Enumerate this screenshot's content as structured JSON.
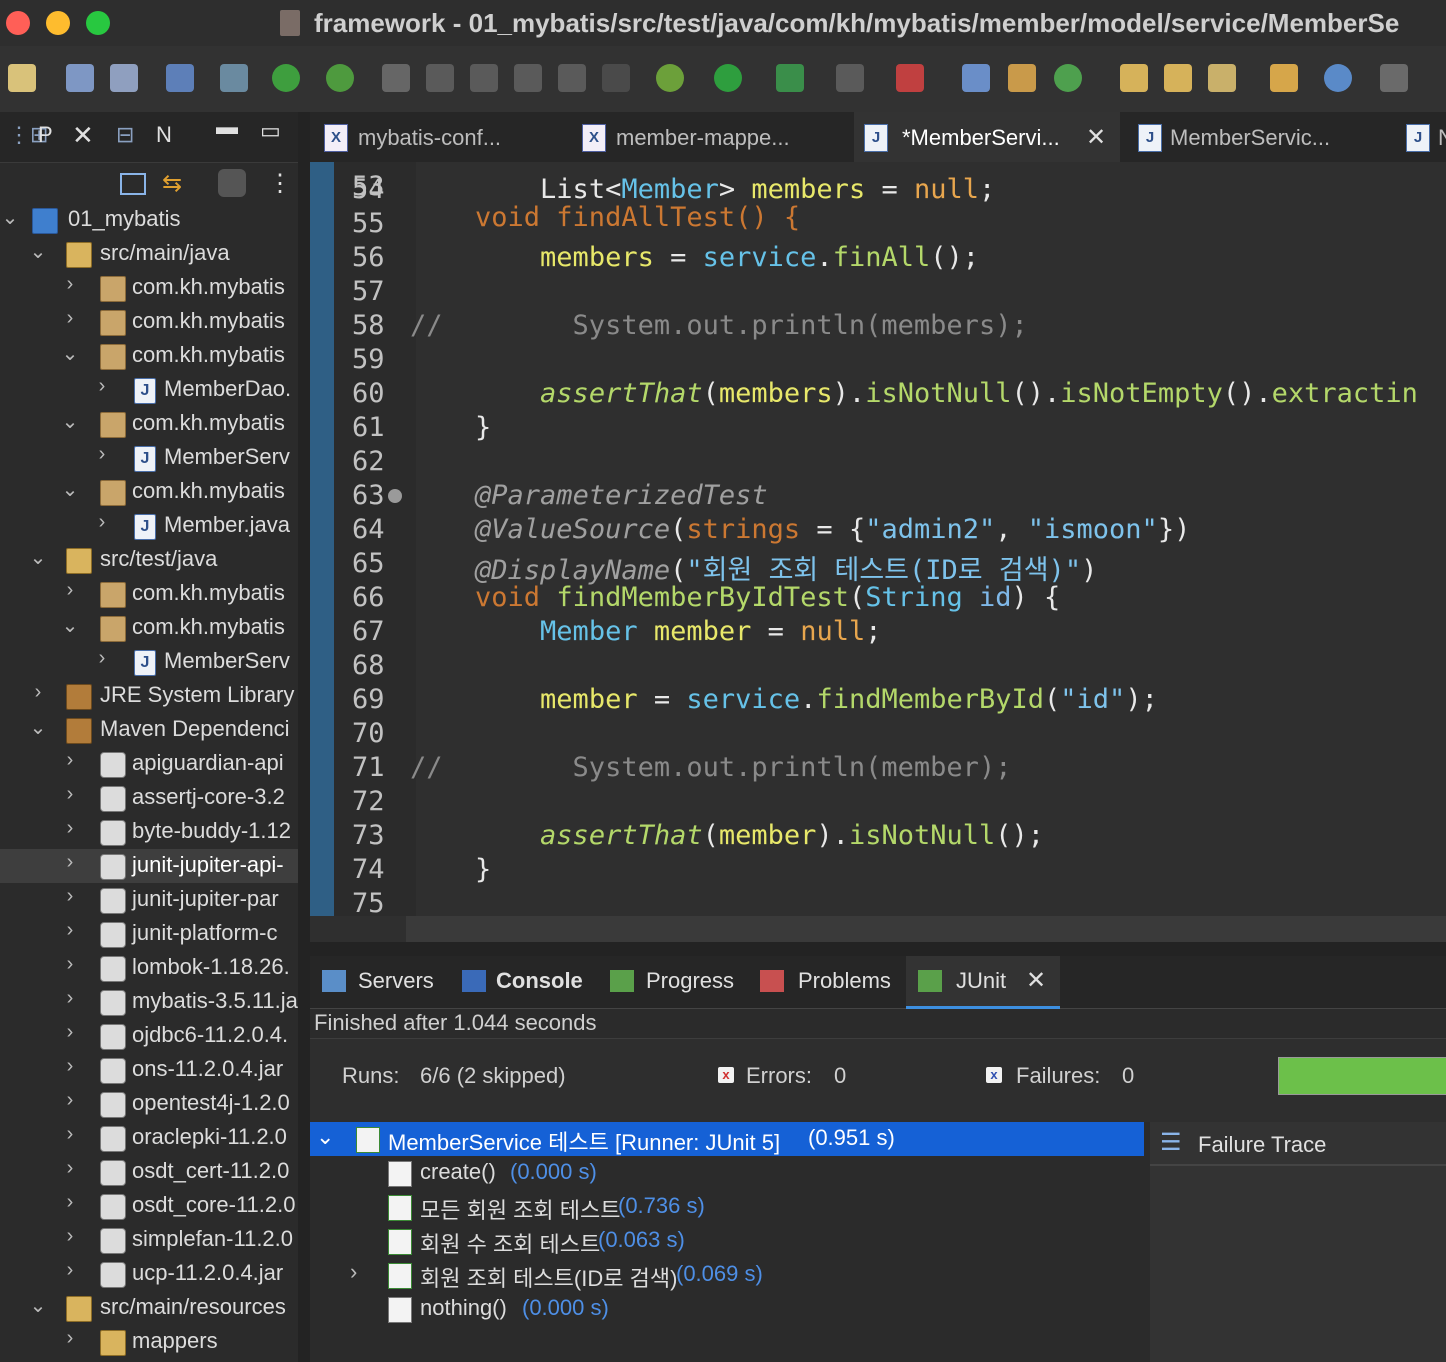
{
  "window": {
    "title": "framework - 01_mybatis/src/test/java/com/kh/mybatis/member/model/service/MemberSe"
  },
  "left_panel": {
    "tabs": [
      {
        "label": "P"
      },
      {
        "label": "N"
      }
    ],
    "tree": [
      {
        "label": "01_mybatis"
      },
      {
        "label": "src/main/java"
      },
      {
        "label": "com.kh.mybatis"
      },
      {
        "label": "com.kh.mybatis"
      },
      {
        "label": "com.kh.mybatis"
      },
      {
        "label": "MemberDao."
      },
      {
        "label": "com.kh.mybatis"
      },
      {
        "label": "MemberServ"
      },
      {
        "label": "com.kh.mybatis"
      },
      {
        "label": "Member.java"
      },
      {
        "label": "src/test/java"
      },
      {
        "label": "com.kh.mybatis"
      },
      {
        "label": "com.kh.mybatis"
      },
      {
        "label": "MemberServ"
      },
      {
        "label": "JRE System Library"
      },
      {
        "label": "Maven Dependenci"
      },
      {
        "label": "apiguardian-api"
      },
      {
        "label": "assertj-core-3.2"
      },
      {
        "label": "byte-buddy-1.12"
      },
      {
        "label": "junit-jupiter-api-"
      },
      {
        "label": "junit-jupiter-par"
      },
      {
        "label": "junit-platform-c"
      },
      {
        "label": "lombok-1.18.26."
      },
      {
        "label": "mybatis-3.5.11.ja"
      },
      {
        "label": "ojdbc6-11.2.0.4."
      },
      {
        "label": "ons-11.2.0.4.jar"
      },
      {
        "label": "opentest4j-1.2.0"
      },
      {
        "label": "oraclepki-11.2.0"
      },
      {
        "label": "osdt_cert-11.2.0"
      },
      {
        "label": "osdt_core-11.2.0"
      },
      {
        "label": "simplefan-11.2.0"
      },
      {
        "label": "ucp-11.2.0.4.jar"
      },
      {
        "label": "src/main/resources"
      },
      {
        "label": "mappers"
      }
    ]
  },
  "editor": {
    "tabs": [
      {
        "label": "mybatis-conf..."
      },
      {
        "label": "member-mappe..."
      },
      {
        "label": "*MemberServi..."
      },
      {
        "label": "MemberServic..."
      },
      {
        "label": "N"
      }
    ],
    "partial_line": "    void findAllTest() {",
    "lines": [
      {
        "n": "54",
        "t": "List<Member> members = null;"
      },
      {
        "n": "55",
        "t": ""
      },
      {
        "n": "56",
        "t": "members = service.finAll();"
      },
      {
        "n": "57",
        "t": ""
      },
      {
        "n": "58",
        "t": "//        System.out.println(members);"
      },
      {
        "n": "59",
        "t": ""
      },
      {
        "n": "60",
        "t": "assertThat(members).isNotNull().isNotEmpty().extractin"
      },
      {
        "n": "61",
        "t": "}"
      },
      {
        "n": "62",
        "t": ""
      },
      {
        "n": "63",
        "t": "@ParameterizedTest"
      },
      {
        "n": "64",
        "t": "@ValueSource(strings = {\"admin2\", \"ismoon\"})"
      },
      {
        "n": "65",
        "t": "@DisplayName(\"회원 조회 테스트(ID로 검색)\")"
      },
      {
        "n": "66",
        "t": "void findMemberByIdTest(String id) {"
      },
      {
        "n": "67",
        "t": "Member member = null;"
      },
      {
        "n": "68",
        "t": ""
      },
      {
        "n": "69",
        "t": "member = service.findMemberById(\"id\");"
      },
      {
        "n": "70",
        "t": ""
      },
      {
        "n": "71",
        "t": "//        System.out.println(member);"
      },
      {
        "n": "72",
        "t": ""
      },
      {
        "n": "73",
        "t": "assertThat(member).isNotNull();"
      },
      {
        "n": "74",
        "t": "}"
      },
      {
        "n": "75",
        "t": ""
      }
    ]
  },
  "bottom_panel": {
    "tabs": [
      {
        "label": "Servers"
      },
      {
        "label": "Console"
      },
      {
        "label": "Progress"
      },
      {
        "label": "Problems"
      },
      {
        "label": "JUnit"
      }
    ],
    "status": "Finished after 1.044 seconds",
    "runs_label": "Runs:",
    "runs_value": "6/6 (2 skipped)",
    "errors_label": "Errors:",
    "errors_value": "0",
    "failures_label": "Failures:",
    "failures_value": "0",
    "progress": 1.0,
    "progress_color": "#6cc04a",
    "failure_trace_label": "Failure Trace",
    "tests": [
      {
        "name": "MemberService 테스트 [Runner: JUnit 5]",
        "time": "(0.951 s)"
      },
      {
        "name": "create()",
        "time": "(0.000 s)"
      },
      {
        "name": "모든 회원 조회 테스트",
        "time": "(0.736 s)"
      },
      {
        "name": "회원 수 조회 테스트",
        "time": "(0.063 s)"
      },
      {
        "name": "회원 조회 테스트(ID로 검색)",
        "time": "(0.069 s)"
      },
      {
        "name": "nothing()",
        "time": "(0.000 s)"
      }
    ]
  },
  "colors": {
    "selection": "#1561d6",
    "accent": "#3d8fe0",
    "keyword": "#cc7832",
    "string": "#7ec3ec",
    "test_time": "#4e8fe6"
  }
}
